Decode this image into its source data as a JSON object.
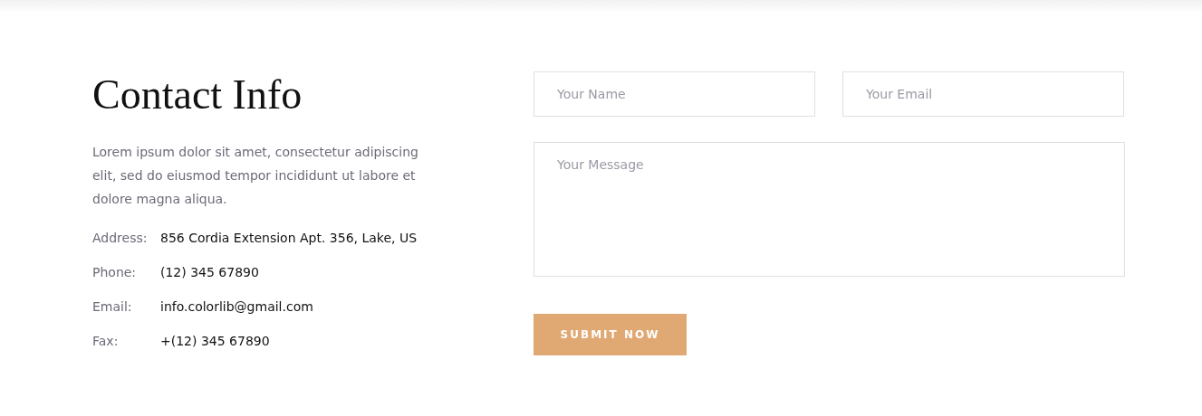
{
  "contact": {
    "title": "Contact Info",
    "description": "Lorem ipsum dolor sit amet, consectetur adipiscing elit, sed do eiusmod tempor incididunt ut labore et dolore magna aliqua.",
    "details": [
      {
        "label": "Address:",
        "value": "856 Cordia Extension Apt. 356, Lake, US"
      },
      {
        "label": "Phone:",
        "value": "(12) 345 67890"
      },
      {
        "label": "Email:",
        "value": "info.colorlib@gmail.com"
      },
      {
        "label": "Fax:",
        "value": "+(12) 345 67890"
      }
    ]
  },
  "form": {
    "name": {
      "placeholder": "Your Name"
    },
    "email": {
      "placeholder": "Your Email"
    },
    "message": {
      "placeholder": "Your Message"
    },
    "submit": "SUBMIT NOW"
  }
}
